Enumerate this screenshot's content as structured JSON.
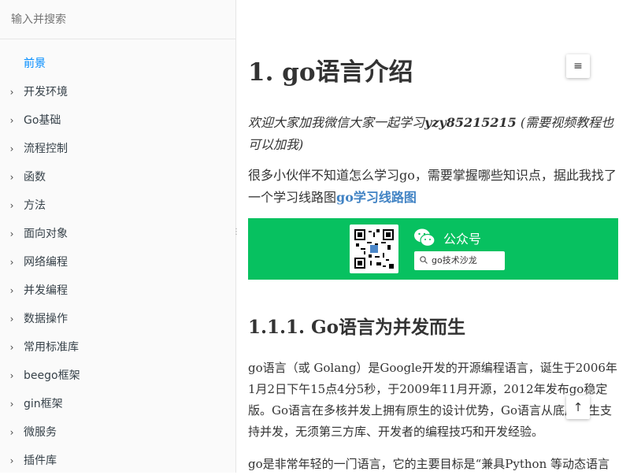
{
  "search": {
    "placeholder": "输入并搜索"
  },
  "nav": {
    "items": [
      {
        "label": "前景",
        "active": true
      },
      {
        "label": "开发环境"
      },
      {
        "label": "Go基础"
      },
      {
        "label": "流程控制"
      },
      {
        "label": "函数"
      },
      {
        "label": "方法"
      },
      {
        "label": "面向对象"
      },
      {
        "label": "网络编程"
      },
      {
        "label": "并发编程"
      },
      {
        "label": "数据操作"
      },
      {
        "label": "常用标准库"
      },
      {
        "label": "beego框架"
      },
      {
        "label": "gin框架"
      },
      {
        "label": "微服务"
      },
      {
        "label": "插件库"
      }
    ]
  },
  "article": {
    "title": "1. go语言介绍",
    "intro_prefix": "欢迎大家加我微信大家一起学习",
    "wechat_id": "yzy85215215",
    "intro_suffix": "(需要视频教程也可以加我)",
    "para2_text": "很多小伙伴不知道怎么学习go，需要掌握哪些知识点，据此我找了一个学习线路图",
    "para2_link": "go学习线路图",
    "banner": {
      "label": "公众号",
      "search_text": "go技术沙龙"
    },
    "h2": "1.1.1. Go语言为并发而生",
    "para3": "go语言（或 Golang）是Google开发的开源编程语言，诞生于2006年1月2日下午15点4分5秒，于2009年11月开源，2012年发布go稳定版。Go语言在多核并发上拥有原生的设计优势，Go语言从底层原生支持并发，无须第三方库、开发者的编程技巧和开发经验。",
    "para4": "go是非常年轻的一门语言，它的主要目标是“兼具Python 等动态语言"
  },
  "icons": {
    "toc": "list-icon",
    "top": "arrow-up-icon",
    "chevron": "chevron-right-icon"
  },
  "colors": {
    "accent": "#008cff",
    "link": "#4183c4",
    "banner": "#07c160"
  }
}
